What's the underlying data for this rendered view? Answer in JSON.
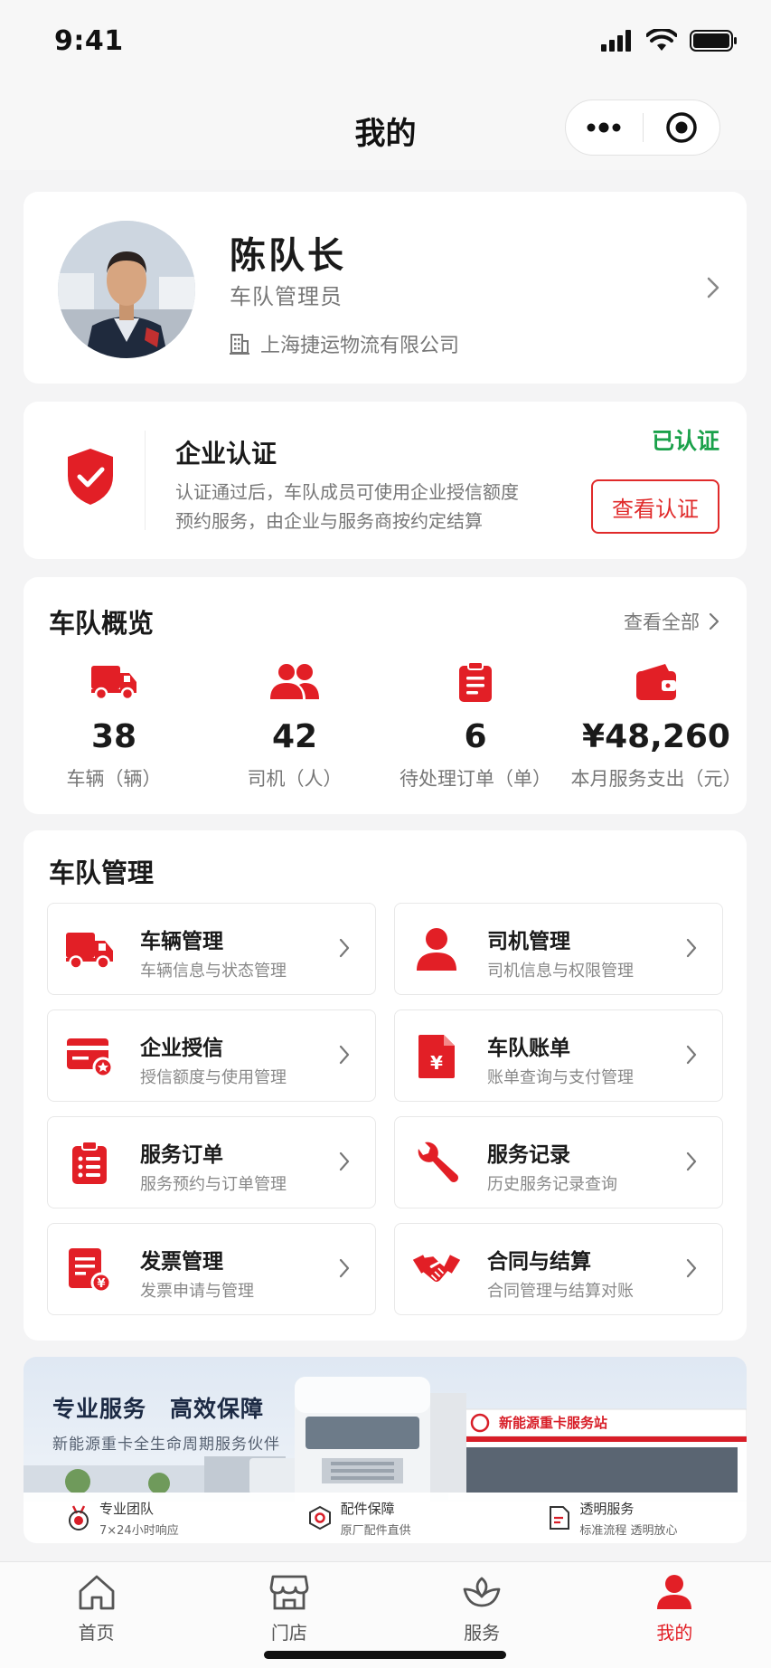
{
  "status_bar": {
    "time": "9:41"
  },
  "nav": {
    "title": "我的",
    "more_icon": "more-dots-icon",
    "close_icon": "target-icon"
  },
  "profile": {
    "name": "陈队长",
    "role": "车队管理员",
    "company": "上海捷运物流有限公司",
    "company_icon": "building-icon"
  },
  "certification": {
    "title": "企业认证",
    "description_line1": "认证通过后，车队成员可使用企业授信额度",
    "description_line2": "预约服务，由企业与服务商按约定结算",
    "status": "已认证",
    "button_label": "查看认证",
    "status_color": "#1aa14a"
  },
  "overview": {
    "title": "车队概览",
    "see_all": "查看全部",
    "stats": [
      {
        "icon": "truck-icon",
        "value": "38",
        "label": "车辆（辆）"
      },
      {
        "icon": "people-icon",
        "value": "42",
        "label": "司机（人）"
      },
      {
        "icon": "clipboard-icon",
        "value": "6",
        "label": "待处理订单（单）"
      },
      {
        "icon": "wallet-icon",
        "value": "¥48,260",
        "label": "本月服务支出（元）"
      }
    ]
  },
  "management": {
    "title": "车队管理",
    "tiles": [
      {
        "icon": "truck-icon",
        "title": "车辆管理",
        "subtitle": "车辆信息与状态管理"
      },
      {
        "icon": "person-icon",
        "title": "司机管理",
        "subtitle": "司机信息与权限管理"
      },
      {
        "icon": "credit-card-icon",
        "title": "企业授信",
        "subtitle": "授信额度与使用管理"
      },
      {
        "icon": "bill-icon",
        "title": "车队账单",
        "subtitle": "账单查询与支付管理"
      },
      {
        "icon": "order-list-icon",
        "title": "服务订单",
        "subtitle": "服务预约与订单管理"
      },
      {
        "icon": "wrench-icon",
        "title": "服务记录",
        "subtitle": "历史服务记录查询"
      },
      {
        "icon": "invoice-icon",
        "title": "发票管理",
        "subtitle": "发票申请与管理"
      },
      {
        "icon": "handshake-icon",
        "title": "合同与结算",
        "subtitle": "合同管理与结算对账"
      }
    ]
  },
  "banner": {
    "title": "专业服务　高效保障",
    "subtitle": "新能源重卡全生命周期服务伙伴",
    "station_sign": "新能源重卡服务站",
    "features": [
      {
        "icon": "medal-icon",
        "title": "专业团队",
        "subtitle": "7×24小时响应"
      },
      {
        "icon": "parts-icon",
        "title": "配件保障",
        "subtitle": "原厂配件直供"
      },
      {
        "icon": "document-icon",
        "title": "透明服务",
        "subtitle": "标准流程 透明放心"
      }
    ]
  },
  "tabbar": {
    "tabs": [
      {
        "icon": "home-icon",
        "label": "首页",
        "active": false
      },
      {
        "icon": "store-icon",
        "label": "门店",
        "active": false
      },
      {
        "icon": "service-icon",
        "label": "服务",
        "active": false
      },
      {
        "icon": "profile-icon",
        "label": "我的",
        "active": true
      }
    ]
  },
  "colors": {
    "accent": "#e21f26",
    "success": "#1aa14a",
    "background": "#f4f4f5"
  }
}
